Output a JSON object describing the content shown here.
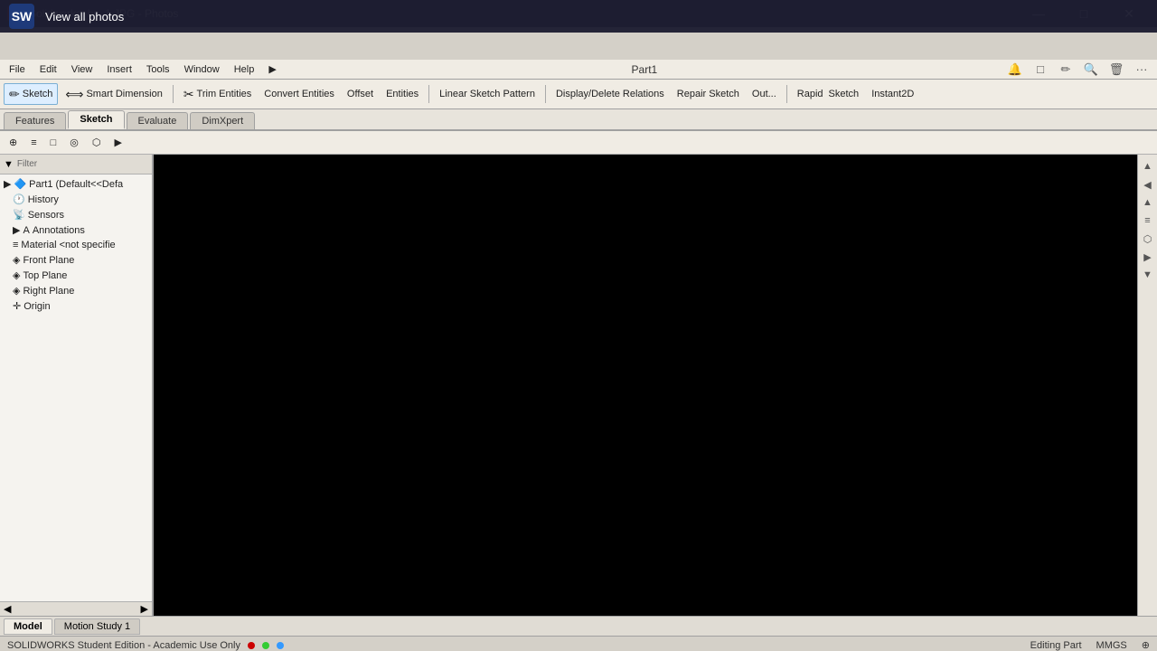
{
  "window": {
    "title": "Solidworks_bs_1.JPG - Photos",
    "controls": [
      "—",
      "□",
      "✕"
    ]
  },
  "photos_bar": {
    "icon": "SW",
    "label": "View all photos"
  },
  "menu": {
    "items": [
      "File",
      "Edit",
      "View",
      "Insert",
      "Tools",
      "Window",
      "Help",
      "▶"
    ],
    "center_title": "Part1",
    "icons": [
      "🔔",
      "□",
      "✏",
      "🔍",
      "🗑",
      "···"
    ]
  },
  "toolbar": {
    "sketch_label": "Sketch",
    "smart_dim_label": "Smart Dimension",
    "tools": [
      "Trim Entities",
      "Convert Entities",
      "Offset Entities",
      "Linear Sketch Pattern",
      "Display/Delete Relations",
      "Repair Sketch",
      "Out...",
      "Rapid Sketch",
      "Instant2D"
    ],
    "sub_icons": [
      "□",
      "◯",
      "◯",
      "A",
      "↩",
      "◯",
      "◯"
    ]
  },
  "tabs": {
    "items": [
      "Features",
      "Sketch",
      "Evaluate",
      "DimXpert"
    ],
    "active": 1
  },
  "toolbar2": {
    "icons": [
      "⊕",
      "≡",
      "□",
      "◎",
      "⬡",
      "▶"
    ]
  },
  "feature_tree": {
    "header_icon": "▼",
    "items": [
      {
        "label": "Part1  (Default<<Defa",
        "icon": "🔷",
        "level": 0,
        "expand": true
      },
      {
        "label": "History",
        "icon": "🕐",
        "level": 1
      },
      {
        "label": "Sensors",
        "icon": "📡",
        "level": 1
      },
      {
        "label": "Annotations",
        "icon": "A",
        "level": 1,
        "expand": true
      },
      {
        "label": "Material <not specifie",
        "icon": "≡",
        "level": 1
      },
      {
        "label": "Front Plane",
        "icon": "◈",
        "level": 1
      },
      {
        "label": "Top Plane",
        "icon": "◈",
        "level": 1
      },
      {
        "label": "Right Plane",
        "icon": "◈",
        "level": 1
      },
      {
        "label": "Origin",
        "icon": "✛",
        "level": 1
      }
    ]
  },
  "right_toolbar": {
    "icons": [
      "▲",
      "◀",
      "▲",
      "≡",
      "⬡",
      "▶",
      "▼"
    ]
  },
  "bottom_tabs": {
    "items": [
      "Model",
      "Motion Study 1"
    ],
    "active": 0
  },
  "status_bar": {
    "left": "SOLIDWORKS Student Edition - Academic Use Only",
    "segments": [
      {
        "color": "#cc0000",
        "text": ""
      },
      {
        "color": "#33cc33",
        "text": ""
      },
      {
        "color": "#3399ff",
        "text": ""
      }
    ],
    "right_items": [
      "Editing Part",
      "MMGS"
    ],
    "cursor_icon": "⊕"
  }
}
